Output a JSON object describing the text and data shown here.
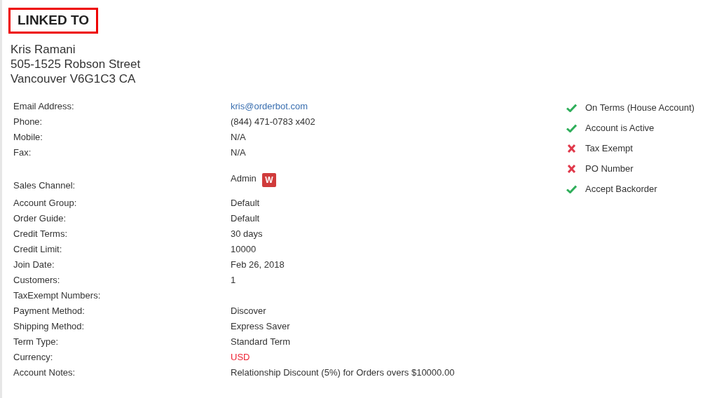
{
  "heading": "LINKED TO",
  "address": [
    "Kris Ramani",
    "505-1525 Robson Street",
    "Vancouver V6G1C3 CA"
  ],
  "contact_fields": [
    {
      "label": "Email Address:",
      "value": "kris@orderbot.com",
      "kind": "link"
    },
    {
      "label": "Phone:",
      "value": "(844) 471-0783 x402",
      "kind": "text"
    },
    {
      "label": "Mobile:",
      "value": "N/A",
      "kind": "text"
    },
    {
      "label": "Fax:",
      "value": "N/A",
      "kind": "text"
    }
  ],
  "account_fields": [
    {
      "label": "Sales Channel:",
      "value": "Admin",
      "kind": "badge",
      "badge": "W"
    },
    {
      "label": "Account Group:",
      "value": "Default",
      "kind": "text"
    },
    {
      "label": "Order Guide:",
      "value": "Default",
      "kind": "text"
    },
    {
      "label": "Credit Terms:",
      "value": "30 days",
      "kind": "text"
    },
    {
      "label": "Credit Limit:",
      "value": "10000",
      "kind": "text"
    },
    {
      "label": "Join Date:",
      "value": "Feb 26, 2018",
      "kind": "text"
    },
    {
      "label": "Customers:",
      "value": "1",
      "kind": "text"
    },
    {
      "label": "TaxExempt Numbers:",
      "kind": "text"
    },
    {
      "label": "Payment Method:",
      "value": "Discover",
      "kind": "text"
    },
    {
      "label": "Shipping Method:",
      "value": "Express Saver",
      "kind": "text"
    },
    {
      "label": "Term Type:",
      "value": "Standard Term",
      "kind": "text"
    },
    {
      "label": "Currency:",
      "value": "USD",
      "kind": "alert"
    },
    {
      "label": "Account Notes:",
      "value": "Relationship Discount (5%) for Orders overs $10000.00",
      "kind": "text"
    }
  ],
  "flags": [
    {
      "label": "On Terms (House Account)",
      "checked": true
    },
    {
      "label": "Account is Active",
      "checked": true
    },
    {
      "label": "Tax Exempt",
      "checked": false
    },
    {
      "label": "PO Number",
      "checked": false
    },
    {
      "label": "Accept Backorder",
      "checked": true
    }
  ]
}
